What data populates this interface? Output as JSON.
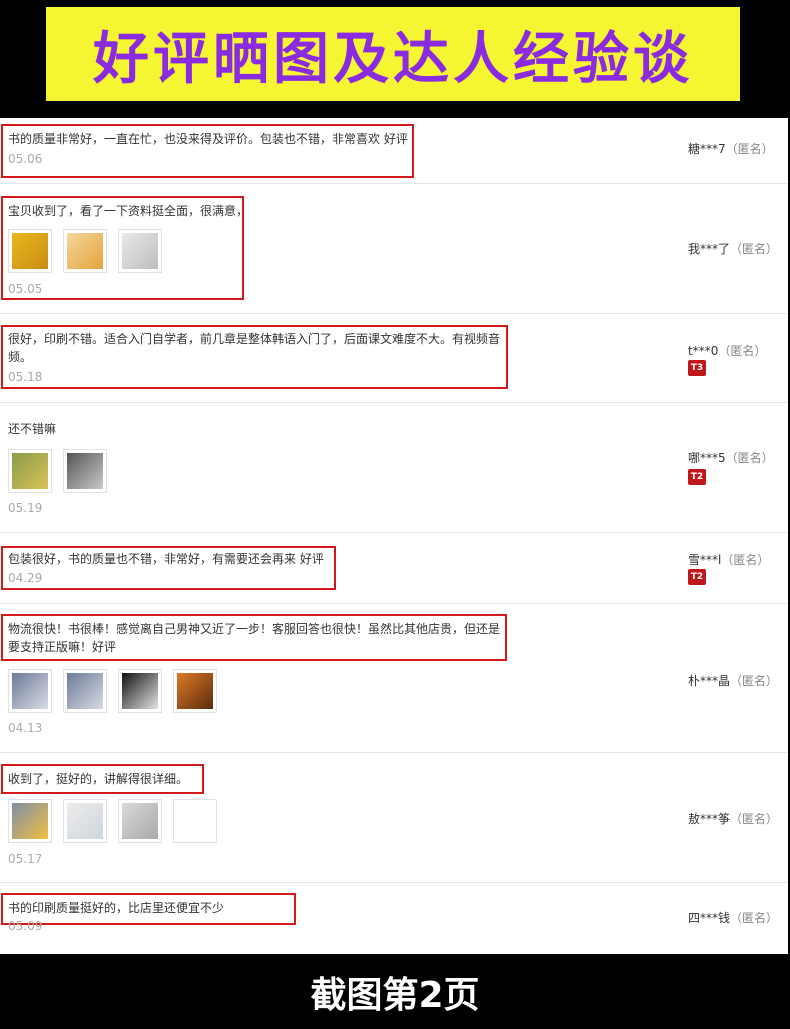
{
  "banner": {
    "title": "好评晒图及达人经验谈"
  },
  "reviews": [
    {
      "text": "书的质量非常好，一直在忙，也没来得及评价。包装也不错，非常喜欢 好评",
      "date": "05.06",
      "user": "糖***7",
      "anon": "（匿名）"
    },
    {
      "text": "宝贝收到了，看了一下资料挺全面，很满意，",
      "date": "05.05",
      "user": "我***了",
      "anon": "（匿名）",
      "images": [
        "book-cover-yellow",
        "book-yellow-angled",
        "page-scan"
      ]
    },
    {
      "text": "很好，印刷不错。适合入门自学者，前几章是整体韩语入门了，后面课文难度不大。有视频音频。",
      "date": "05.18",
      "user": "t***0",
      "anon": "（匿名）",
      "badge": "T3"
    },
    {
      "text": "还不错嘛",
      "date": "05.19",
      "user": "哪***5",
      "anon": "（匿名）",
      "badge": "T2",
      "images": [
        "book-cover-green",
        "page-scan-dark"
      ]
    },
    {
      "text": "包装很好，书的质量也不错，非常好，有需要还会再来 好评",
      "date": "04.29",
      "user": "雪***l",
      "anon": "（匿名）",
      "badge": "T2"
    },
    {
      "text": "物流很快！书很棒！感觉离自己男神又近了一步！客服回答也很快！虽然比其他店贵，但还是要支持正版嘛！好评",
      "date": "04.13",
      "user": "朴***晶",
      "anon": "（匿名）",
      "images": [
        "photo-group",
        "photo-group-2",
        "photo-portrait",
        "photo-orange"
      ]
    },
    {
      "text": "收到了，挺好的，讲解得很详细。",
      "date": "05.17",
      "user": "敖***筝",
      "anon": "（匿名）",
      "images": [
        "page-scan-blue",
        "page-lined",
        "page-scan-grey",
        "blank"
      ]
    },
    {
      "text": "书的印刷质量挺好的，比店里还便宜不少",
      "date": "05.09",
      "user": "四***钱",
      "anon": "（匿名）"
    }
  ],
  "footer": {
    "title": "截图第2页"
  }
}
